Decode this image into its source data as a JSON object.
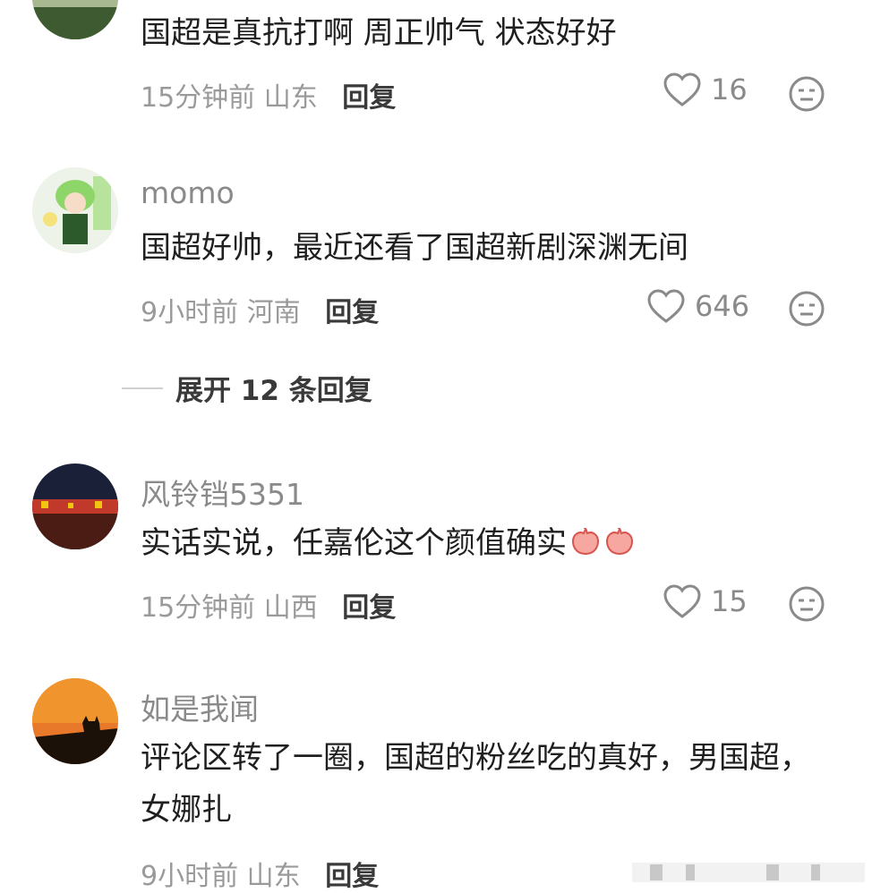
{
  "comments": [
    {
      "text": "国超是真抗打啊  周正帅气  状态好好",
      "time": "15分钟前",
      "location": "山东",
      "reply_label": "回复",
      "likes": "16",
      "avatar_icon": "landscape-avatar"
    },
    {
      "username": "momo",
      "text": "国超好帅，最近还看了国超新剧深渊无间",
      "time": "9小时前",
      "location": "河南",
      "reply_label": "回复",
      "likes": "646",
      "avatar_icon": "green-hair-character-avatar"
    },
    {
      "username": "风铃铛5351",
      "text": "实话实说，任嘉伦这个颜值确实",
      "emojis": [
        "peach-icon",
        "peach-icon"
      ],
      "time": "15分钟前",
      "location": "山西",
      "reply_label": "回复",
      "likes": "15",
      "avatar_icon": "night-city-avatar"
    },
    {
      "username": "如是我闻",
      "text": "评论区转了一圈，国超的粉丝吃的真好，男国超，女娜扎",
      "time": "9小时前",
      "location": "山东",
      "reply_label": "回复",
      "avatar_icon": "sunset-cat-avatar"
    }
  ],
  "expand_replies": "展开 12 条回复",
  "colors": {
    "username": "#8a8a8a",
    "meta": "#9a9a9a",
    "text": "#1f1f1f"
  }
}
